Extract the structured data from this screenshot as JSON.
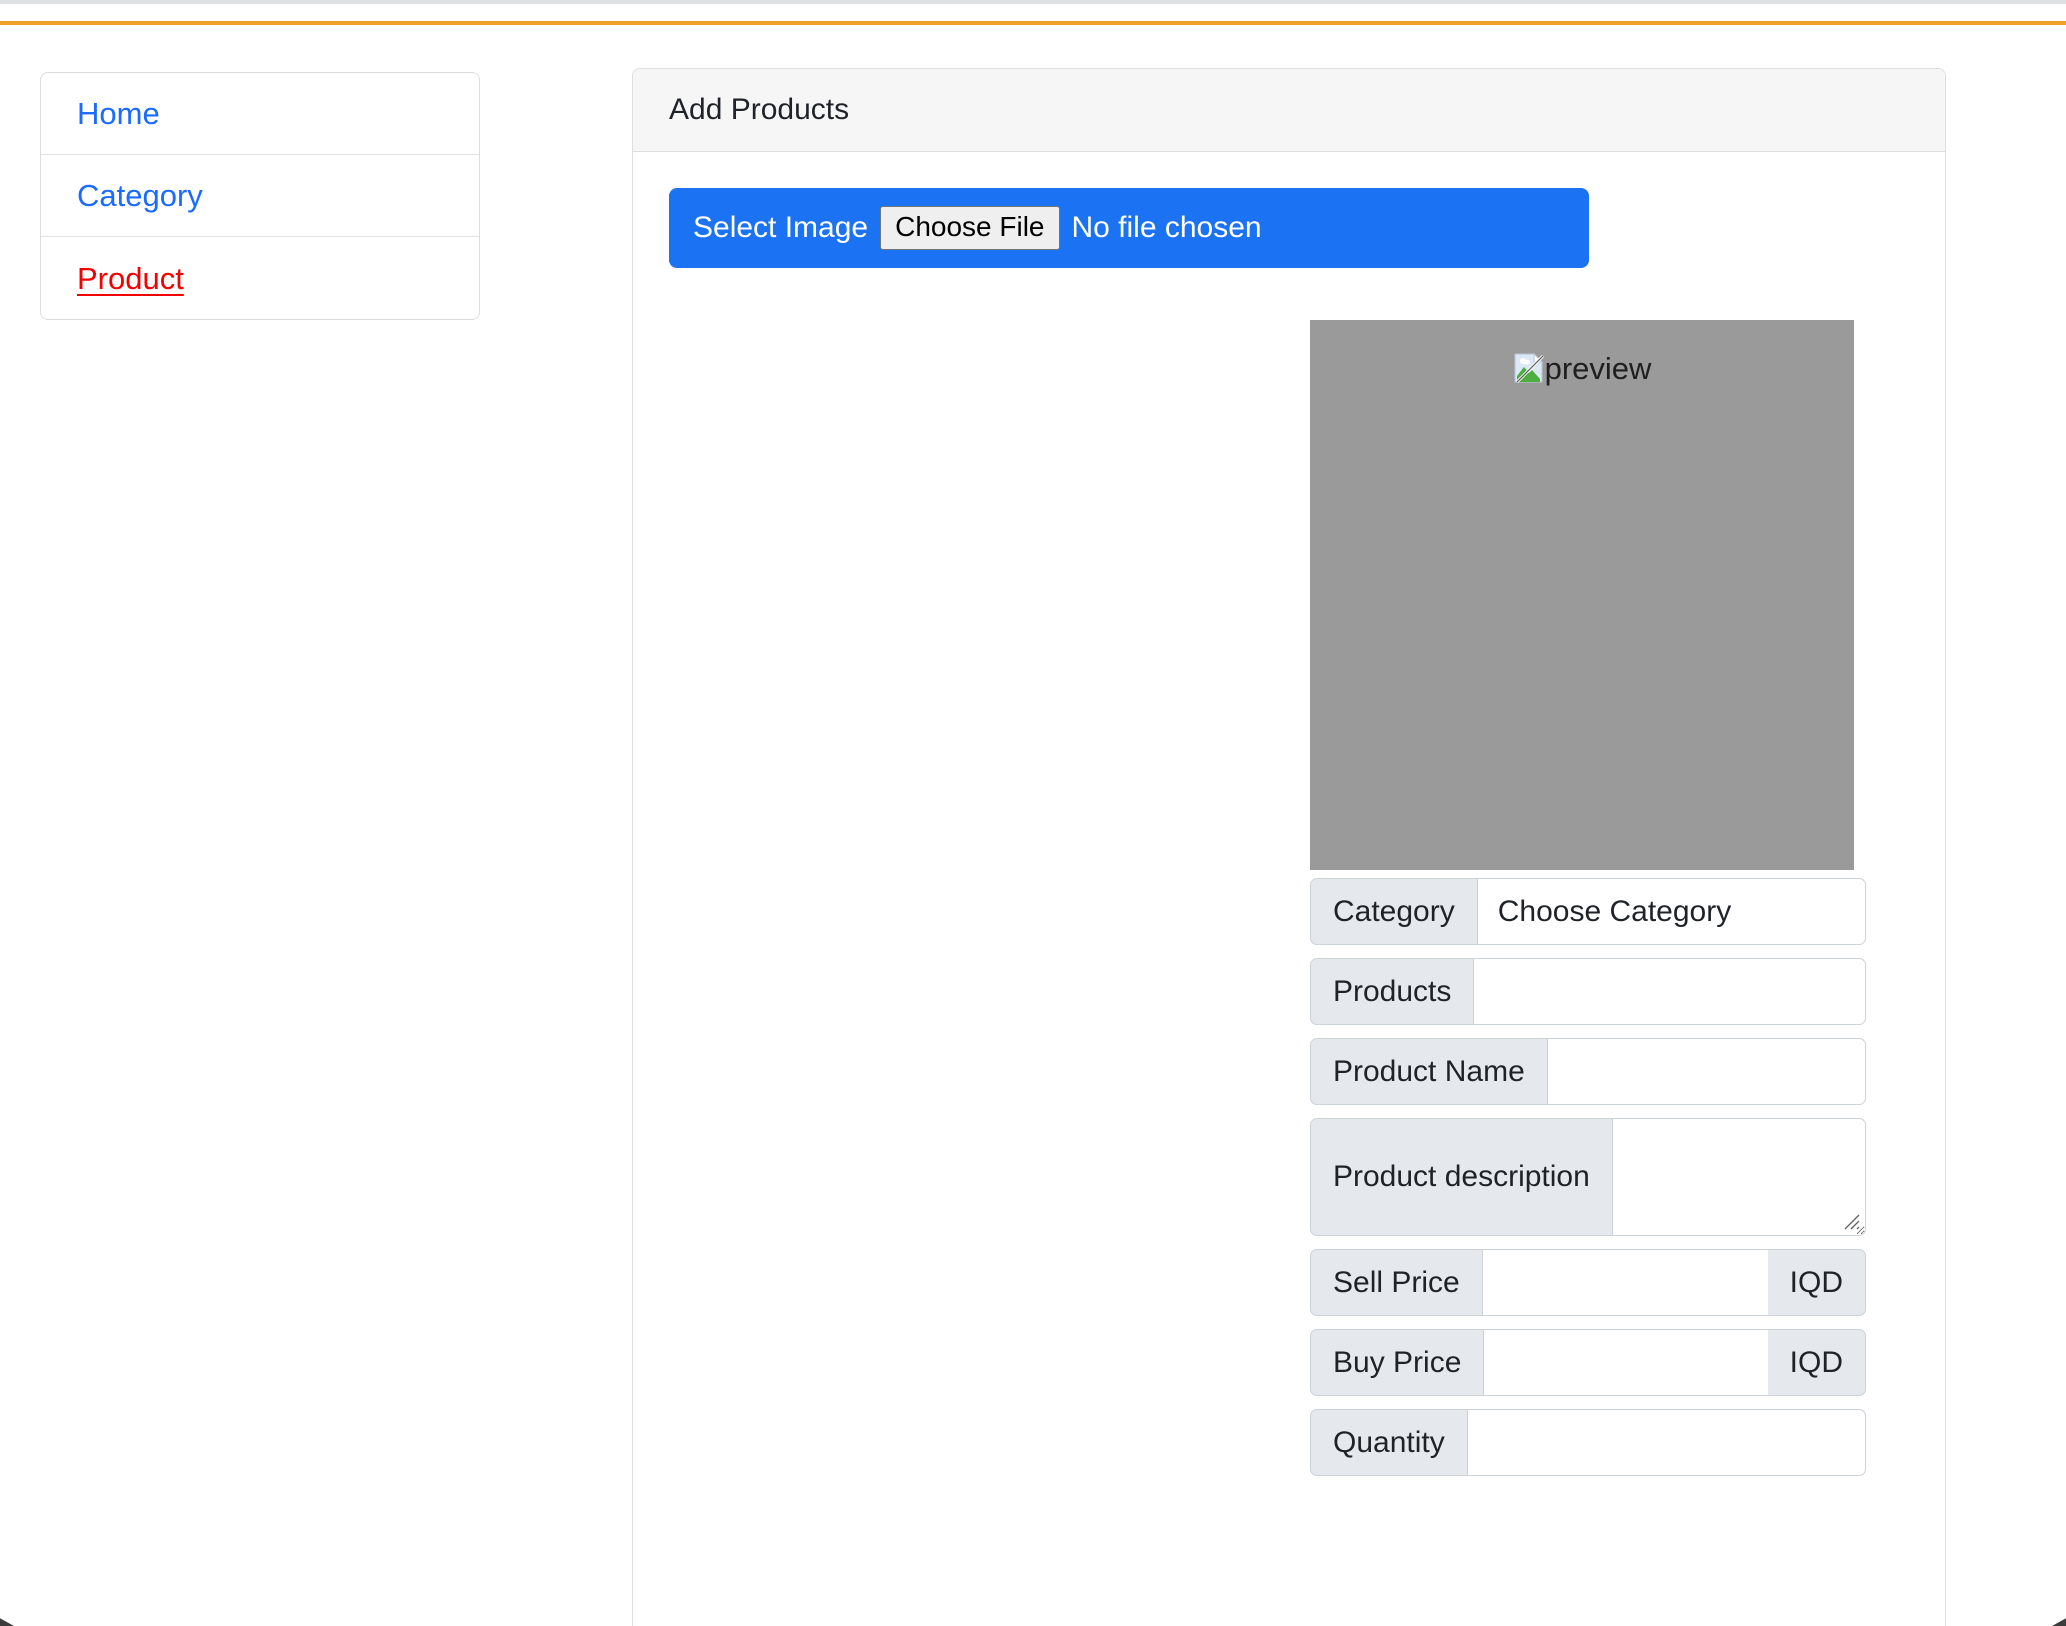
{
  "window": {
    "accent_color": "#f0a229",
    "chrome_strip_color": "#e0e1e2"
  },
  "sidebar": {
    "items": [
      {
        "label": "Home",
        "state": "link"
      },
      {
        "label": "Category",
        "state": "link"
      },
      {
        "label": "Product",
        "state": "active"
      }
    ],
    "link_color": "#1a6bff",
    "active_color": "#f40000"
  },
  "card": {
    "header_title": "Add Products"
  },
  "file_input": {
    "label": "Select Image",
    "button_label": "Choose File",
    "status": "No file chosen",
    "background_color": "#1b72f2"
  },
  "preview": {
    "alt_text": "preview",
    "icon": "broken-image-icon",
    "placeholder_color": "#9a9a9a"
  },
  "form": {
    "rows": [
      {
        "name": "category",
        "label": "Category",
        "control": "select",
        "value": "Choose Category",
        "options": [
          "Choose Category"
        ],
        "suffix": null,
        "placeholder": ""
      },
      {
        "name": "products",
        "label": "Products",
        "control": "input",
        "value": "",
        "suffix": null,
        "placeholder": ""
      },
      {
        "name": "product-name",
        "label": "Product Name",
        "control": "input",
        "value": "",
        "suffix": null,
        "placeholder": ""
      },
      {
        "name": "product-description",
        "label": "Product description",
        "control": "textarea",
        "value": "",
        "suffix": null,
        "placeholder": ""
      },
      {
        "name": "sell-price",
        "label": "Sell Price",
        "control": "input",
        "value": "",
        "suffix": "IQD",
        "placeholder": ""
      },
      {
        "name": "buy-price",
        "label": "Buy Price",
        "control": "input",
        "value": "",
        "suffix": "IQD",
        "placeholder": ""
      },
      {
        "name": "quantity",
        "label": "Quantity",
        "control": "input",
        "value": "",
        "suffix": null,
        "placeholder": ""
      }
    ]
  }
}
